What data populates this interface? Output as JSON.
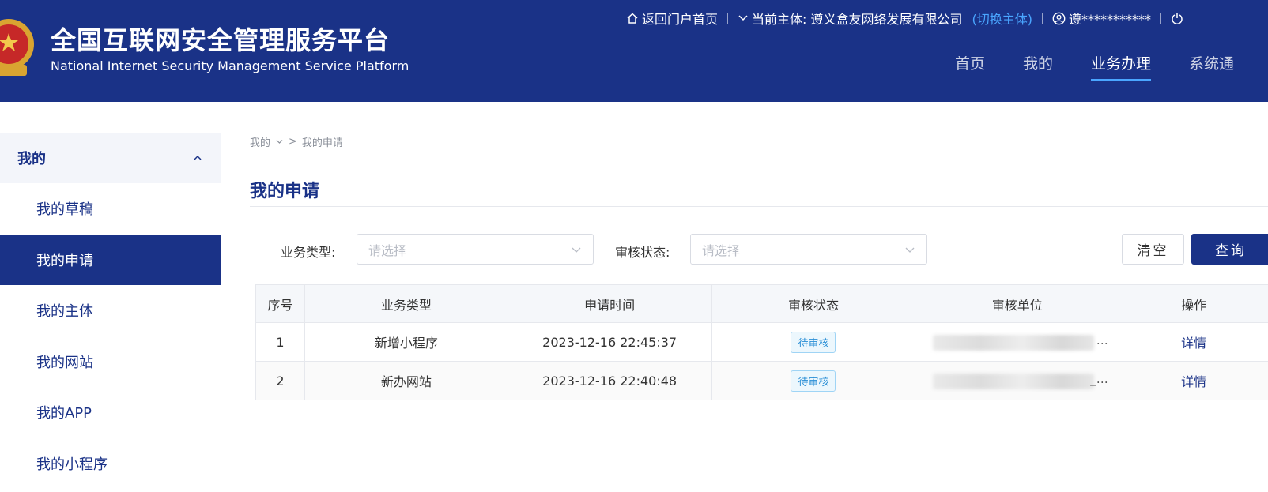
{
  "header": {
    "title": "全国互联网安全管理服务平台",
    "subtitle": "National Internet Security Management Service Platform",
    "portal_link": "返回门户首页",
    "entity_label": "当前主体: 遵义盒友网络发展有限公司",
    "switch_entity": "(切换主体)",
    "user": "遵***********",
    "nav": [
      {
        "label": "首页"
      },
      {
        "label": "我的"
      },
      {
        "label": "业务办理"
      },
      {
        "label": "系统通"
      }
    ]
  },
  "sidebar": {
    "group": "我的",
    "items": [
      {
        "label": "我的草稿"
      },
      {
        "label": "我的申请"
      },
      {
        "label": "我的主体"
      },
      {
        "label": "我的网站"
      },
      {
        "label": "我的APP"
      },
      {
        "label": "我的小程序"
      }
    ]
  },
  "breadcrumb": {
    "parent": "我的",
    "current": "我的申请"
  },
  "page_title": "我的申请",
  "filters": {
    "type_label": "业务类型:",
    "type_placeholder": "请选择",
    "status_label": "审核状态:",
    "status_placeholder": "请选择",
    "clear_button": "清空",
    "query_button": "查询"
  },
  "table": {
    "columns": [
      "序号",
      "业务类型",
      "申请时间",
      "审核状态",
      "审核单位",
      "操作"
    ],
    "rows": [
      {
        "index": "1",
        "type": "新增小程序",
        "time": "2023-12-16 22:45:37",
        "status": "待审核",
        "unit_tail": "…",
        "action": "详情"
      },
      {
        "index": "2",
        "type": "新办网站",
        "time": "2023-12-16 22:40:48",
        "status": "待审核",
        "unit_tail": "_…",
        "action": "详情"
      }
    ]
  },
  "colors": {
    "primary": "#1a3287",
    "accent": "#4aa6ff"
  }
}
